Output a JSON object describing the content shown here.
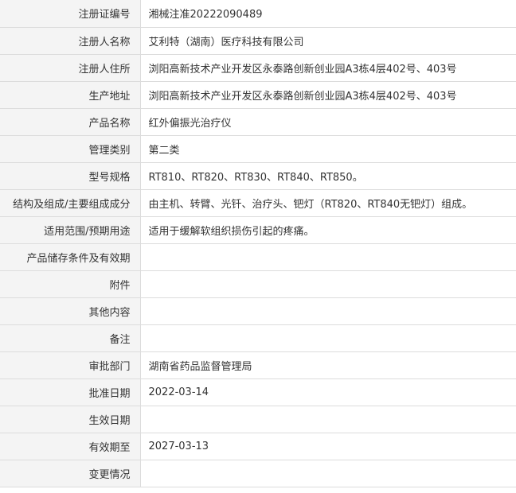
{
  "record": {
    "rows": [
      {
        "label": "注册证编号",
        "value": "湘械注准20222090489"
      },
      {
        "label": "注册人名称",
        "value": "艾利特（湖南）医疗科技有限公司"
      },
      {
        "label": "注册人住所",
        "value": "浏阳高新技术产业开发区永泰路创新创业园A3栋4层402号、403号"
      },
      {
        "label": "生产地址",
        "value": "浏阳高新技术产业开发区永泰路创新创业园A3栋4层402号、403号"
      },
      {
        "label": "产品名称",
        "value": "红外偏振光治疗仪"
      },
      {
        "label": "管理类别",
        "value": "第二类"
      },
      {
        "label": "型号规格",
        "value": "RT810、RT820、RT830、RT840、RT850。"
      },
      {
        "label": "结构及组成/主要组成成分",
        "value": "由主机、转臂、光钎、治疗头、钯灯（RT820、RT840无钯灯）组成。"
      },
      {
        "label": "适用范围/预期用途",
        "value": "适用于缓解软组织损伤引起的疼痛。"
      },
      {
        "label": "产品储存条件及有效期",
        "value": ""
      },
      {
        "label": "附件",
        "value": ""
      },
      {
        "label": "其他内容",
        "value": ""
      },
      {
        "label": "备注",
        "value": ""
      },
      {
        "label": "审批部门",
        "value": "湖南省药品监督管理局"
      },
      {
        "label": "批准日期",
        "value": "2022-03-14"
      },
      {
        "label": "生效日期",
        "value": ""
      },
      {
        "label": "有效期至",
        "value": "2027-03-13"
      },
      {
        "label": "变更情况",
        "value": ""
      }
    ]
  }
}
